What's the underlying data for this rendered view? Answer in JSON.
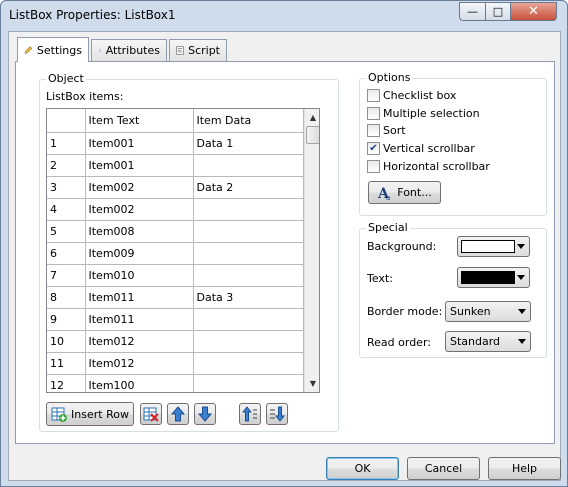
{
  "window": {
    "title": "ListBox Properties: ListBox1",
    "minimize_glyph": "—",
    "maximize_glyph": "□",
    "close_glyph": "✕"
  },
  "tabs": [
    {
      "label": "Settings",
      "icon": "pencil-icon",
      "active": true
    },
    {
      "label": "Attributes",
      "icon": "wand-icon",
      "active": false
    },
    {
      "label": "Script",
      "icon": "script-icon",
      "active": false
    }
  ],
  "object_group": {
    "title": "Object",
    "listbox_label": "ListBox items:",
    "columns": [
      "",
      "Item Text",
      "Item Data"
    ],
    "rows": [
      [
        "1",
        "Item001",
        "Data 1"
      ],
      [
        "2",
        "Item001",
        ""
      ],
      [
        "3",
        "Item002",
        "Data 2"
      ],
      [
        "4",
        "Item002",
        ""
      ],
      [
        "5",
        "Item008",
        ""
      ],
      [
        "6",
        "Item009",
        ""
      ],
      [
        "7",
        "Item010",
        ""
      ],
      [
        "8",
        "Item011",
        "Data 3"
      ],
      [
        "9",
        "Item011",
        ""
      ],
      [
        "10",
        "Item012",
        ""
      ],
      [
        "11",
        "Item012",
        ""
      ],
      [
        "12",
        "Item100",
        ""
      ]
    ],
    "insert_row_label": "Insert Row",
    "toolbar_icons": [
      "delete-row-icon",
      "move-up-icon",
      "move-down-icon",
      "sort-ascending-icon",
      "sort-descending-icon"
    ]
  },
  "options_group": {
    "title": "Options",
    "checkboxes": [
      {
        "label": "Checklist box",
        "checked": false
      },
      {
        "label": "Multiple selection",
        "checked": false
      },
      {
        "label": "Sort",
        "checked": false
      },
      {
        "label": "Vertical scrollbar",
        "checked": true
      },
      {
        "label": "Horizontal scrollbar",
        "checked": false
      }
    ],
    "checkmark_glyph": "✔",
    "font_button_label": "Font..."
  },
  "special_group": {
    "title": "Special",
    "background_label": "Background:",
    "background_color": "#ffffff",
    "text_label": "Text:",
    "text_color": "#000000",
    "border_mode_label": "Border mode:",
    "border_mode_value": "Sunken",
    "read_order_label": "Read order:",
    "read_order_value": "Standard"
  },
  "dialog_buttons": {
    "ok": "OK",
    "cancel": "Cancel",
    "help": "Help"
  }
}
